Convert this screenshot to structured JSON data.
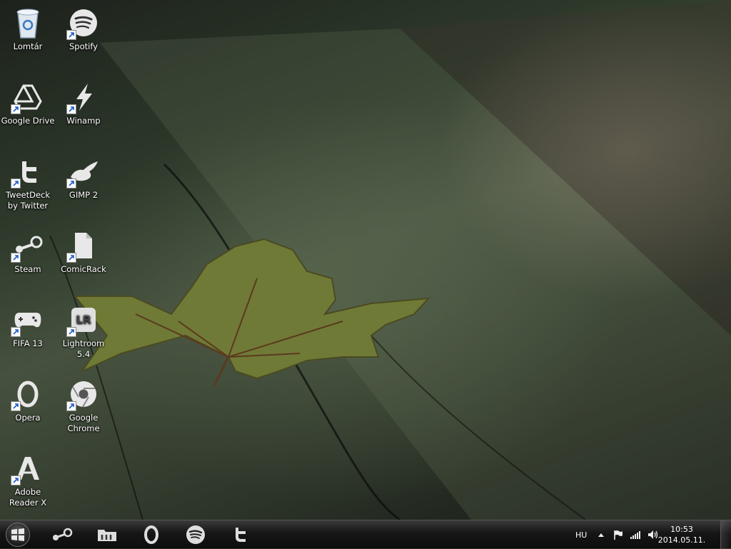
{
  "desktop_icons": [
    {
      "id": "lomtar",
      "label": "Lomtár",
      "icon": "recycle-bin-icon"
    },
    {
      "id": "spotify",
      "label": "Spotify",
      "icon": "spotify-icon"
    },
    {
      "id": "google-drive",
      "label": "Google Drive",
      "icon": "google-drive-icon"
    },
    {
      "id": "winamp",
      "label": "Winamp",
      "icon": "winamp-icon"
    },
    {
      "id": "tweetdeck",
      "label": "TweetDeck by Twitter",
      "icon": "tweetdeck-icon"
    },
    {
      "id": "gimp",
      "label": "GIMP 2",
      "icon": "gimp-icon"
    },
    {
      "id": "steam",
      "label": "Steam",
      "icon": "steam-icon"
    },
    {
      "id": "comicrack",
      "label": "ComicRack",
      "icon": "comicrack-icon"
    },
    {
      "id": "fifa",
      "label": "FIFA 13",
      "icon": "gamepad-icon"
    },
    {
      "id": "lightroom",
      "label": "Lightroom 5.4",
      "icon": "lightroom-icon",
      "glyph": "LR"
    },
    {
      "id": "opera",
      "label": "Opera",
      "icon": "opera-icon"
    },
    {
      "id": "chrome",
      "label": "Google Chrome",
      "icon": "chrome-icon"
    },
    {
      "id": "adobe-reader",
      "label": "Adobe Reader X",
      "icon": "adobe-reader-icon"
    }
  ],
  "taskbar": {
    "start": {
      "icon": "windows-logo-icon"
    },
    "pinned": [
      {
        "id": "steam",
        "icon": "steam-icon"
      },
      {
        "id": "explorer",
        "icon": "folder-icon"
      },
      {
        "id": "opera",
        "icon": "opera-icon"
      },
      {
        "id": "spotify",
        "icon": "spotify-icon"
      },
      {
        "id": "tweetdeck",
        "icon": "tweetdeck-icon"
      }
    ],
    "tray": {
      "language": "HU",
      "icons": [
        "show-hidden-icons-icon",
        "action-center-flag-icon",
        "network-signal-icon",
        "volume-icon"
      ]
    },
    "clock": {
      "time": "10:53",
      "date": "2014.05.11."
    }
  }
}
